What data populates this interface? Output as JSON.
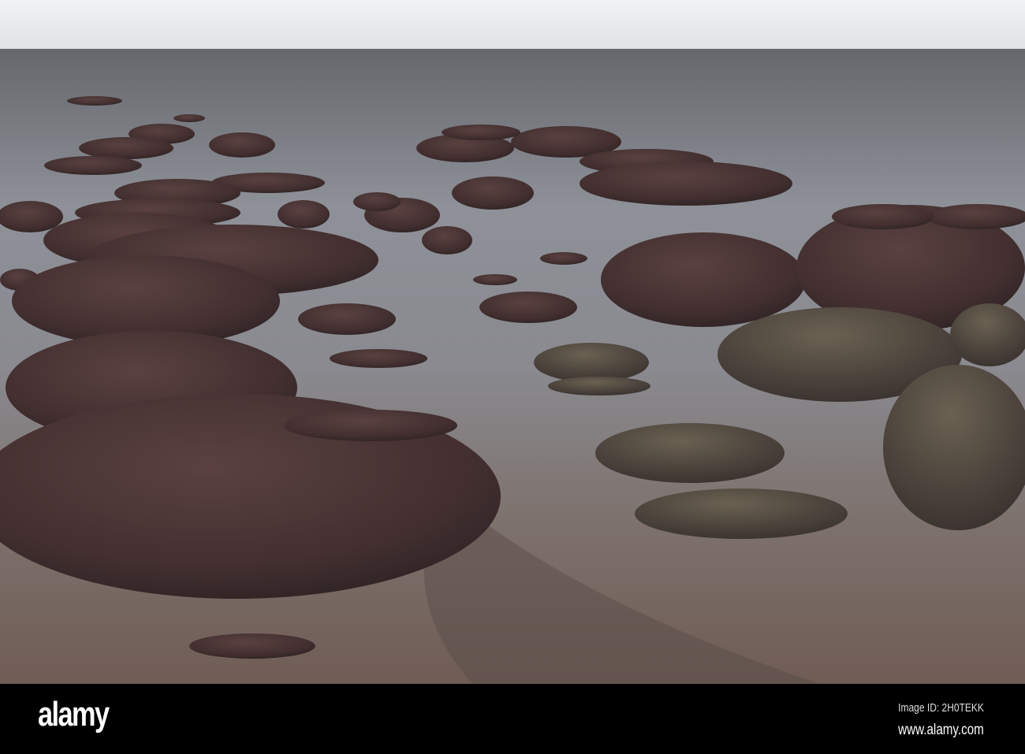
{
  "watermark": {
    "logo": "alamy",
    "image_id": "Image ID: 2H0TEKK",
    "url": "www.alamy.com"
  },
  "colors": {
    "sky": "#e9ecee",
    "sea_far": "#6e6f74",
    "water_near": "#7a6c66",
    "rock": "#4a3534"
  }
}
